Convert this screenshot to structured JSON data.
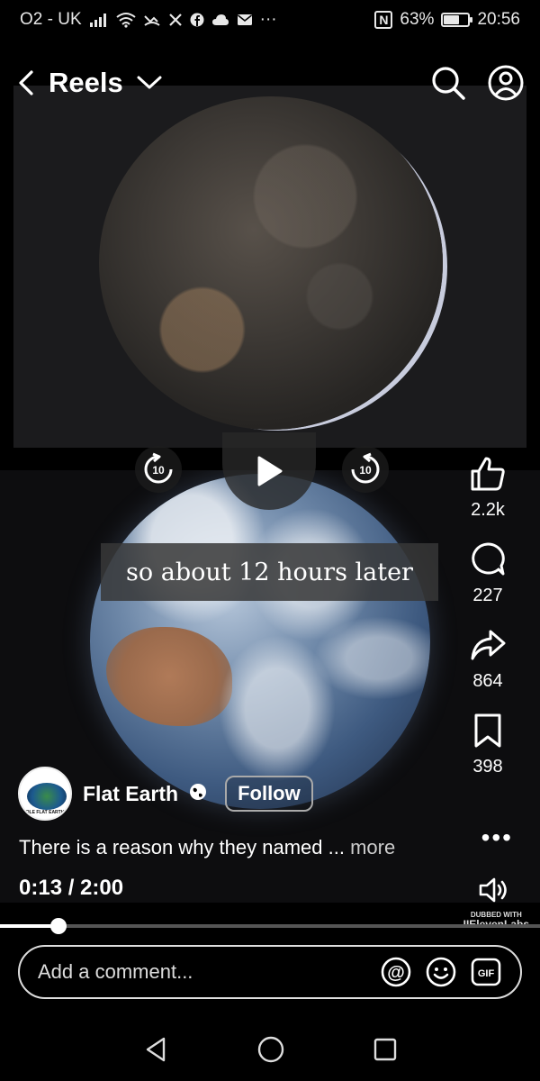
{
  "status_bar": {
    "carrier": "O2 - UK",
    "battery_percent": "63%",
    "battery_level": 0.63,
    "time": "20:56",
    "more_indicator": "···",
    "nfc_label": "N"
  },
  "header": {
    "title": "Reels"
  },
  "video": {
    "caption": "so about 12 hours later",
    "rewind_label": "10",
    "forward_label": "10"
  },
  "actions": {
    "likes": "2.2k",
    "comments": "227",
    "shares": "864",
    "saves": "398"
  },
  "creator": {
    "name": "Flat Earth",
    "follow_label": "Follow",
    "avatar_text": "OLE FLAT EARTH"
  },
  "description": {
    "text": "There is a reason why they named ...",
    "more_label": "more"
  },
  "playback": {
    "time": "0:13 / 2:00",
    "progress": 0.108,
    "dubbed_label": "DUBBED WITH",
    "dubbed_brand": "IIElevenLabs"
  },
  "comment": {
    "placeholder": "Add a comment...",
    "at_label": "@",
    "gif_label": "GIF"
  },
  "colors": {
    "background": "#000000",
    "text": "#ffffff",
    "progress_track": "#555555"
  }
}
